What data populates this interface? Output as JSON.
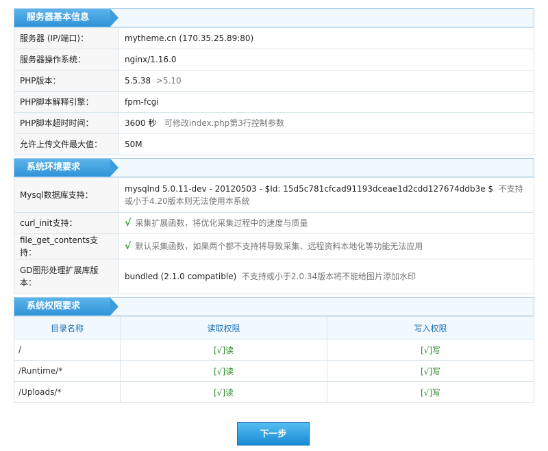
{
  "sections": {
    "basic": {
      "title": "服务器基本信息",
      "rows": [
        {
          "label": "服务器 (IP/端口)：",
          "value": "mytheme.cn (170.35.25.89:80)",
          "note": ""
        },
        {
          "label": "服务器操作系统：",
          "value": "nginx/1.16.0",
          "note": ""
        },
        {
          "label": "PHP版本：",
          "value": "5.5.38",
          "note": ">5.10"
        },
        {
          "label": "PHP脚本解释引擎：",
          "value": "fpm-fcgi",
          "note": ""
        },
        {
          "label": "PHP脚本超时时间：",
          "value": "3600 秒",
          "note": "可修改index.php第3行控制参数"
        },
        {
          "label": "允许上传文件最大值：",
          "value": "50M",
          "note": ""
        }
      ]
    },
    "env": {
      "title": "系统环境要求",
      "rows": [
        {
          "label": "Mysql数据库支持：",
          "value": "mysqlnd 5.0.11-dev - 20120503 - $Id: 15d5c781cfcad91193dceae1d2cdd127674ddb3e $",
          "note": "不支持或小于4.20版本则无法使用本系统"
        },
        {
          "label": "curl_init支持：",
          "check": "√",
          "note": "采集扩展函数，将优化采集过程中的速度与质量"
        },
        {
          "label": "file_get_contents支持：",
          "check": "√",
          "note": "默认采集函数，如果两个都不支持将导致采集、远程资料本地化等功能无法应用"
        },
        {
          "label": "GD图形处理扩展库版本：",
          "value": "bundled (2.1.0 compatible)",
          "note": "不支持或小于2.0.34版本将不能给图片添加水印"
        }
      ]
    },
    "perm": {
      "title": "系统权限要求",
      "headers": [
        "目录名称",
        "读取权限",
        "写入权限"
      ],
      "rows": [
        {
          "dir": "/",
          "read": "[√]读",
          "write": "[√]写"
        },
        {
          "dir": "/Runtime/*",
          "read": "[√]读",
          "write": "[√]写"
        },
        {
          "dir": "/Uploads/*",
          "read": "[√]读",
          "write": "[√]写"
        }
      ]
    }
  },
  "next_button": "下一步",
  "colors": {
    "accent": "#2f93d8",
    "check": "#2aa12a",
    "header_text": "#1a6fb4"
  }
}
